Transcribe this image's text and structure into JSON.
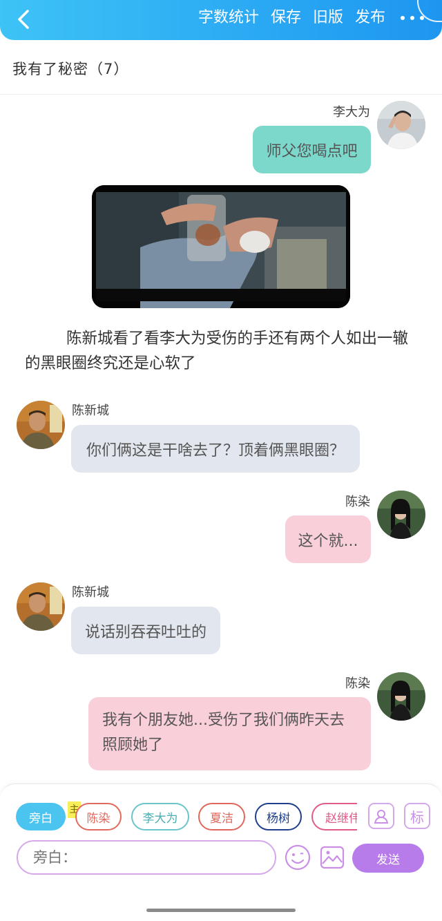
{
  "topbar": {
    "actions": [
      "字数统计",
      "保存",
      "旧版",
      "发布"
    ]
  },
  "story": {
    "title": "我有了秘密（7）"
  },
  "messages": [
    {
      "speaker": "李大为",
      "text": "师父您喝点吧"
    },
    {
      "speaker": "陈新城",
      "text": "你们俩这是干啥去了？顶着俩黑眼圈？"
    },
    {
      "speaker": "陈染",
      "text": "这个就..."
    },
    {
      "speaker": "陈新城",
      "text": "说话别吞吞吐吐的"
    },
    {
      "speaker": "陈染",
      "text": "我有个朋友她...受伤了我们俩昨天去照顾她了"
    }
  ],
  "narration": "陈新城看了看李大为受伤的手还有两个人如出一辙的黑眼圈终究还是心软了",
  "composer": {
    "characters": [
      {
        "label": "旁白",
        "selected": true
      },
      {
        "label": "陈染",
        "badge": "主"
      },
      {
        "label": "李大为"
      },
      {
        "label": "夏洁"
      },
      {
        "label": "杨树"
      },
      {
        "label": "赵继伟"
      }
    ],
    "tag_button": "标",
    "input_placeholder": "旁白：",
    "send_label": "发送"
  },
  "colors": {
    "header_gradient": [
      "#3ec3f6",
      "#1d96f0"
    ],
    "bubble_teal": "#7dd8cc",
    "bubble_gray": "#e2e7ef",
    "bubble_pink": "#f9cfd9",
    "accent_purple": "#b87cea"
  }
}
